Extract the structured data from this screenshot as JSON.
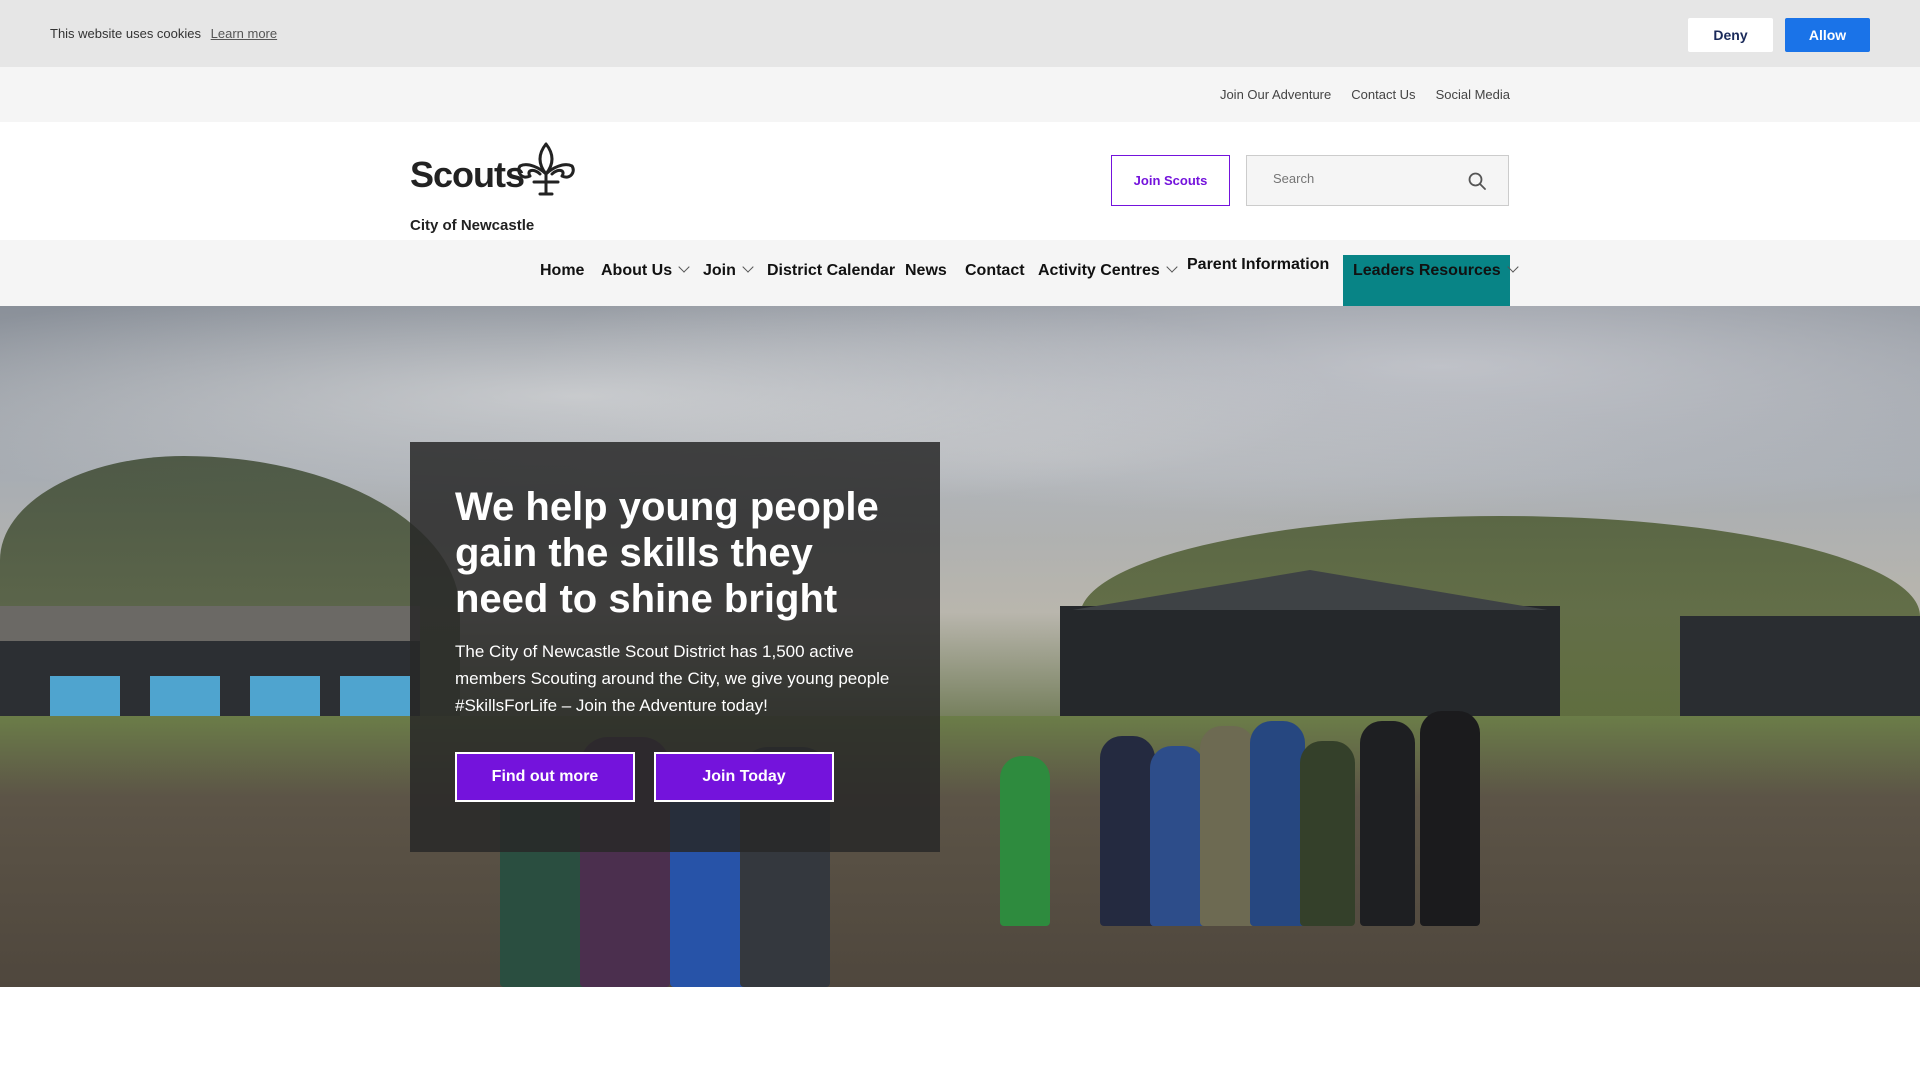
{
  "cookie": {
    "message": "This website uses cookies",
    "learn_more": "Learn more",
    "deny_label": "Deny",
    "allow_label": "Allow"
  },
  "utility_links": [
    "Join Our Adventure",
    "Contact Us",
    "Social Media"
  ],
  "header": {
    "logo_word": "Scouts",
    "logo_sub": "City of Newcastle",
    "join_button": "Join Scouts",
    "search_placeholder": "Search"
  },
  "nav": {
    "items": [
      {
        "label": "Home",
        "has_dropdown": false
      },
      {
        "label": "About Us",
        "has_dropdown": true
      },
      {
        "label": "Join",
        "has_dropdown": true
      },
      {
        "label": "District Calendar",
        "has_dropdown": false
      },
      {
        "label": "News",
        "has_dropdown": false
      },
      {
        "label": "Contact",
        "has_dropdown": false
      },
      {
        "label": "Activity Centres",
        "has_dropdown": true
      },
      {
        "label": "Parent Information",
        "has_dropdown": false
      }
    ],
    "highlighted": {
      "label": "Leaders Resources",
      "has_dropdown": true
    },
    "highlight_color": "#088486"
  },
  "hero": {
    "heading": "We help young people gain the skills they need to shine bright",
    "body": "The City of Newcastle Scout District has 1,500 active members Scouting around the City, we give young people #SkillsForLife – Join the Adventure today!",
    "btn_primary": "Find out more",
    "btn_secondary": "Join Today",
    "accent_color": "#7413dc"
  },
  "colors": {
    "cookie_bg": "#e6e6e6",
    "allow_button": "#1a73e8",
    "scouts_purple": "#7413dc"
  }
}
